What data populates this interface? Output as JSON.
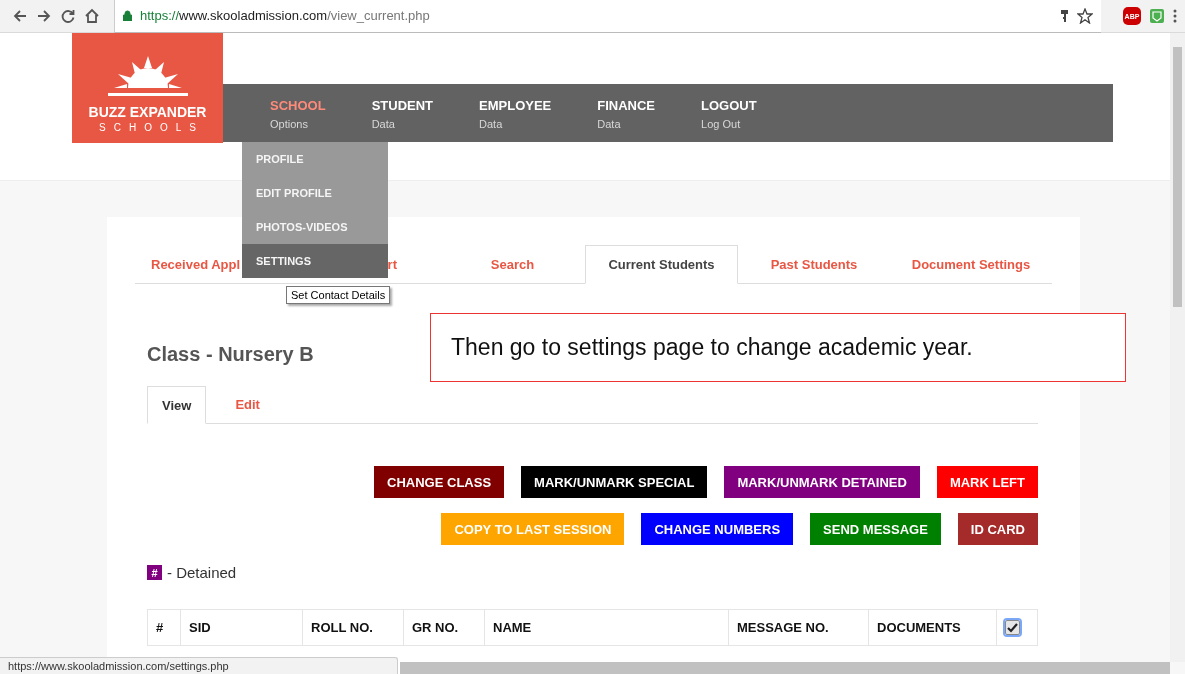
{
  "browser": {
    "url": {
      "scheme": "https://",
      "host": "www.skooladmission.com",
      "path": "/view_current.php"
    },
    "extension_badge": "ABP"
  },
  "logo": {
    "name": "BUZZ EXPANDER",
    "subtitle": "SCHOOLS"
  },
  "nav": {
    "items": [
      {
        "title": "SCHOOL",
        "subtitle": "Options",
        "selected": true,
        "expanded": true,
        "menu": [
          {
            "label": "PROFILE",
            "selected": false
          },
          {
            "label": "EDIT PROFILE",
            "selected": false
          },
          {
            "label": "PHOTOS-VIDEOS",
            "selected": false
          },
          {
            "label": "SETTINGS",
            "selected": true
          }
        ],
        "tooltip": "Set Contact Details"
      },
      {
        "title": "STUDENT",
        "subtitle": "Data",
        "selected": false
      },
      {
        "title": "EMPLOYEE",
        "subtitle": "Data",
        "selected": false
      },
      {
        "title": "FINANCE",
        "subtitle": "Data",
        "selected": false
      },
      {
        "title": "LOGOUT",
        "subtitle": "Log Out",
        "selected": false
      }
    ]
  },
  "tabs": [
    {
      "label": "Received Appl",
      "selected": false
    },
    {
      "label": "rt",
      "selected": false
    },
    {
      "label": "Search",
      "selected": false
    },
    {
      "label": "Current Students",
      "selected": true
    },
    {
      "label": "Past Students",
      "selected": false
    },
    {
      "label": "Document Settings",
      "selected": false
    }
  ],
  "heading": "Class - Nursery B",
  "subtabs": [
    {
      "label": "View",
      "selected": true
    },
    {
      "label": "Edit",
      "selected": false
    }
  ],
  "buttons": [
    [
      {
        "label": "CHANGE CLASS",
        "color": "#800000"
      },
      {
        "label": "MARK/UNMARK SPECIAL",
        "color": "#000000"
      },
      {
        "label": "MARK/UNMARK DETAINED",
        "color": "#800080"
      },
      {
        "label": "MARK LEFT",
        "color": "#ff0000"
      }
    ],
    [
      {
        "label": "COPY TO LAST SESSION",
        "color": "#ffa500"
      },
      {
        "label": "CHANGE NUMBERS",
        "color": "#0000ff"
      },
      {
        "label": "SEND MESSAGE",
        "color": "#008000"
      },
      {
        "label": "ID CARD",
        "color": "#a52a2a"
      }
    ]
  ],
  "legend": {
    "badge": "#",
    "text": "- Detained"
  },
  "table": {
    "columns": [
      "#",
      "SID",
      "ROLL NO.",
      "GR NO.",
      "NAME",
      "MESSAGE NO.",
      "DOCUMENTS"
    ],
    "select_all_checked": true
  },
  "annotation": "Then go to settings page to change academic year.",
  "status_bar": "https://www.skooladmission.com/settings.php"
}
